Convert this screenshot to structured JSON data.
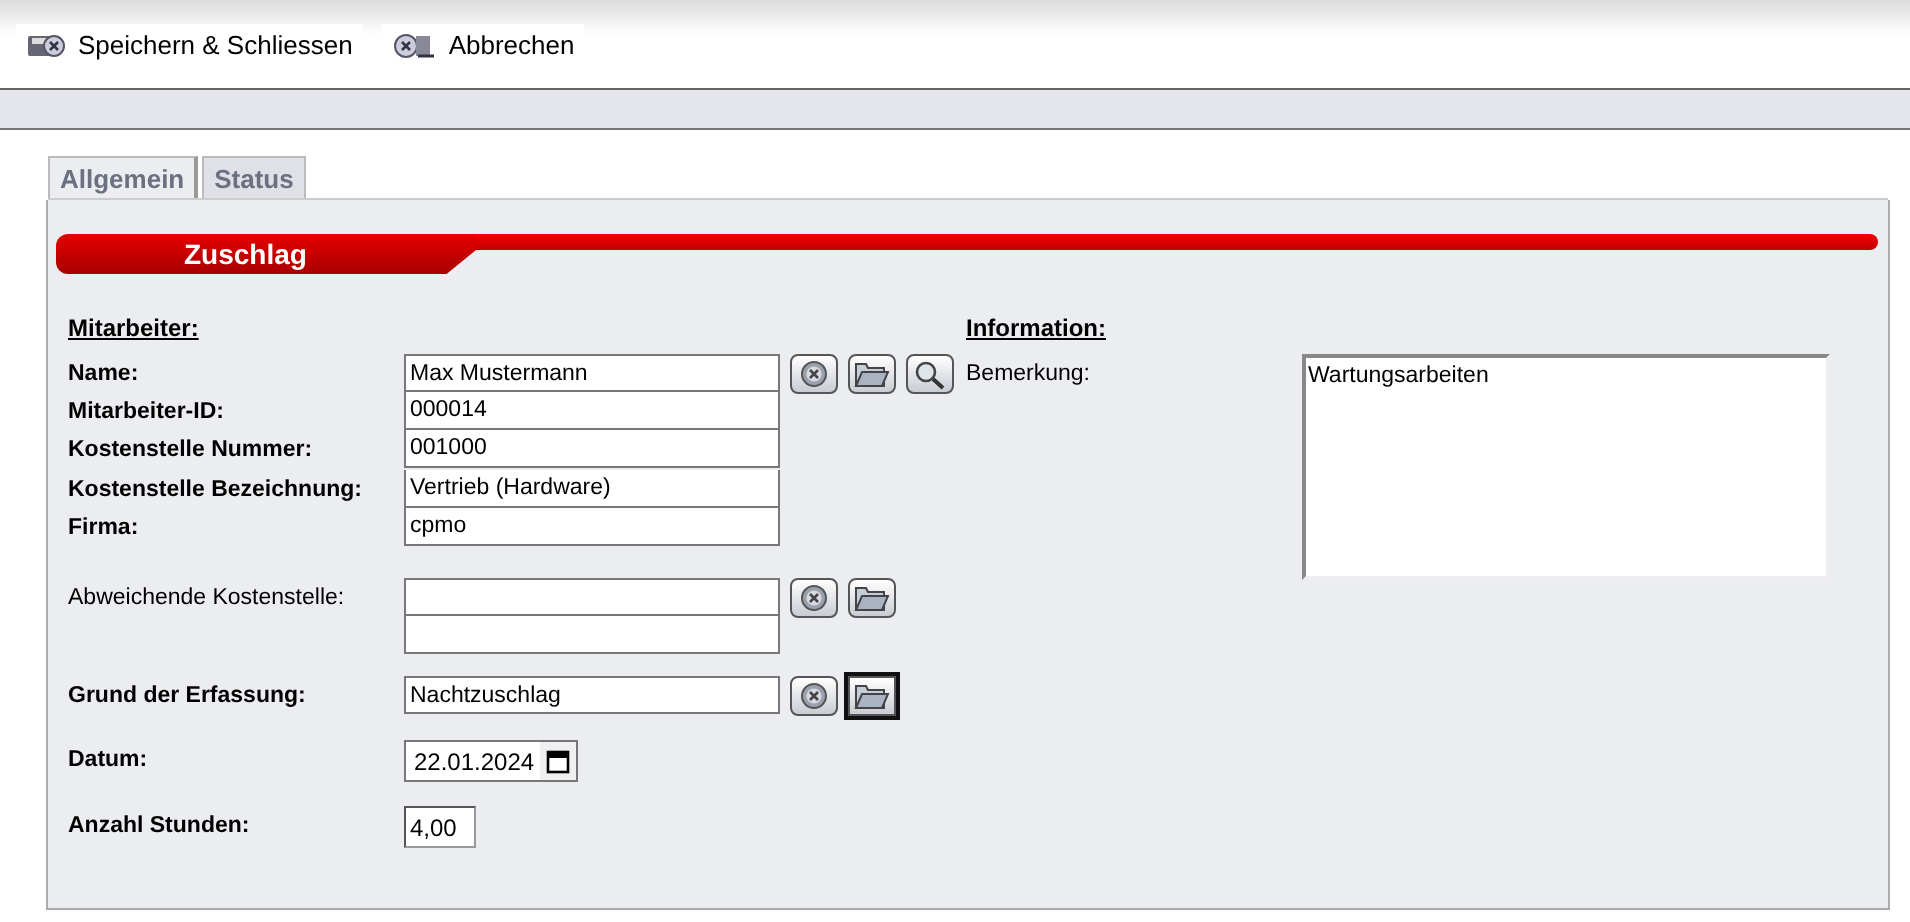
{
  "toolbar": [
    {
      "kind": "save-close",
      "label": "Speichern & Schliessen"
    },
    {
      "kind": "cancel",
      "label": "Abbrechen"
    }
  ],
  "tabs": [
    {
      "label": "Allgemein",
      "selected": true
    },
    {
      "label": "Status",
      "selected": false
    }
  ],
  "section_title": "Zuschlag",
  "employee": {
    "heading": "Mitarbeiter:",
    "fields": [
      {
        "label": "Name:",
        "value": "Max Mustermann",
        "buttons": [
          {
            "kind": "clear",
            "focused": false
          },
          {
            "kind": "open",
            "focused": false
          },
          {
            "kind": "search",
            "focused": false
          }
        ]
      },
      {
        "label": "Mitarbeiter-ID:",
        "value": "000014"
      },
      {
        "label": "Kostenstelle Nummer:",
        "value": "001000"
      },
      {
        "label": "Kostenstelle Bezeichnung:",
        "value": "Vertrieb (Hardware)"
      },
      {
        "label": "Firma:",
        "value": "cpmo"
      }
    ]
  },
  "rows": [
    {
      "kind": "double-lookup",
      "label": "Abweichende Kostenstelle:",
      "bold": false,
      "buttons": [
        {
          "kind": "clear",
          "focused": false
        },
        {
          "kind": "open",
          "focused": false
        }
      ]
    },
    {
      "kind": "lookup",
      "label": "Grund der Erfassung:",
      "bold": true,
      "value": "Nachtzuschlag",
      "buttons": [
        {
          "kind": "clear",
          "focused": false
        },
        {
          "kind": "open",
          "focused": true
        }
      ]
    },
    {
      "kind": "date",
      "label": "Datum:",
      "bold": true,
      "value": "22.01.2024"
    },
    {
      "kind": "number",
      "label": "Anzahl Stunden:",
      "bold": true,
      "value": "4,00"
    }
  ],
  "information": {
    "heading": "Information:",
    "label": "Bemerkung:",
    "value": "Wartungsarbeiten"
  }
}
